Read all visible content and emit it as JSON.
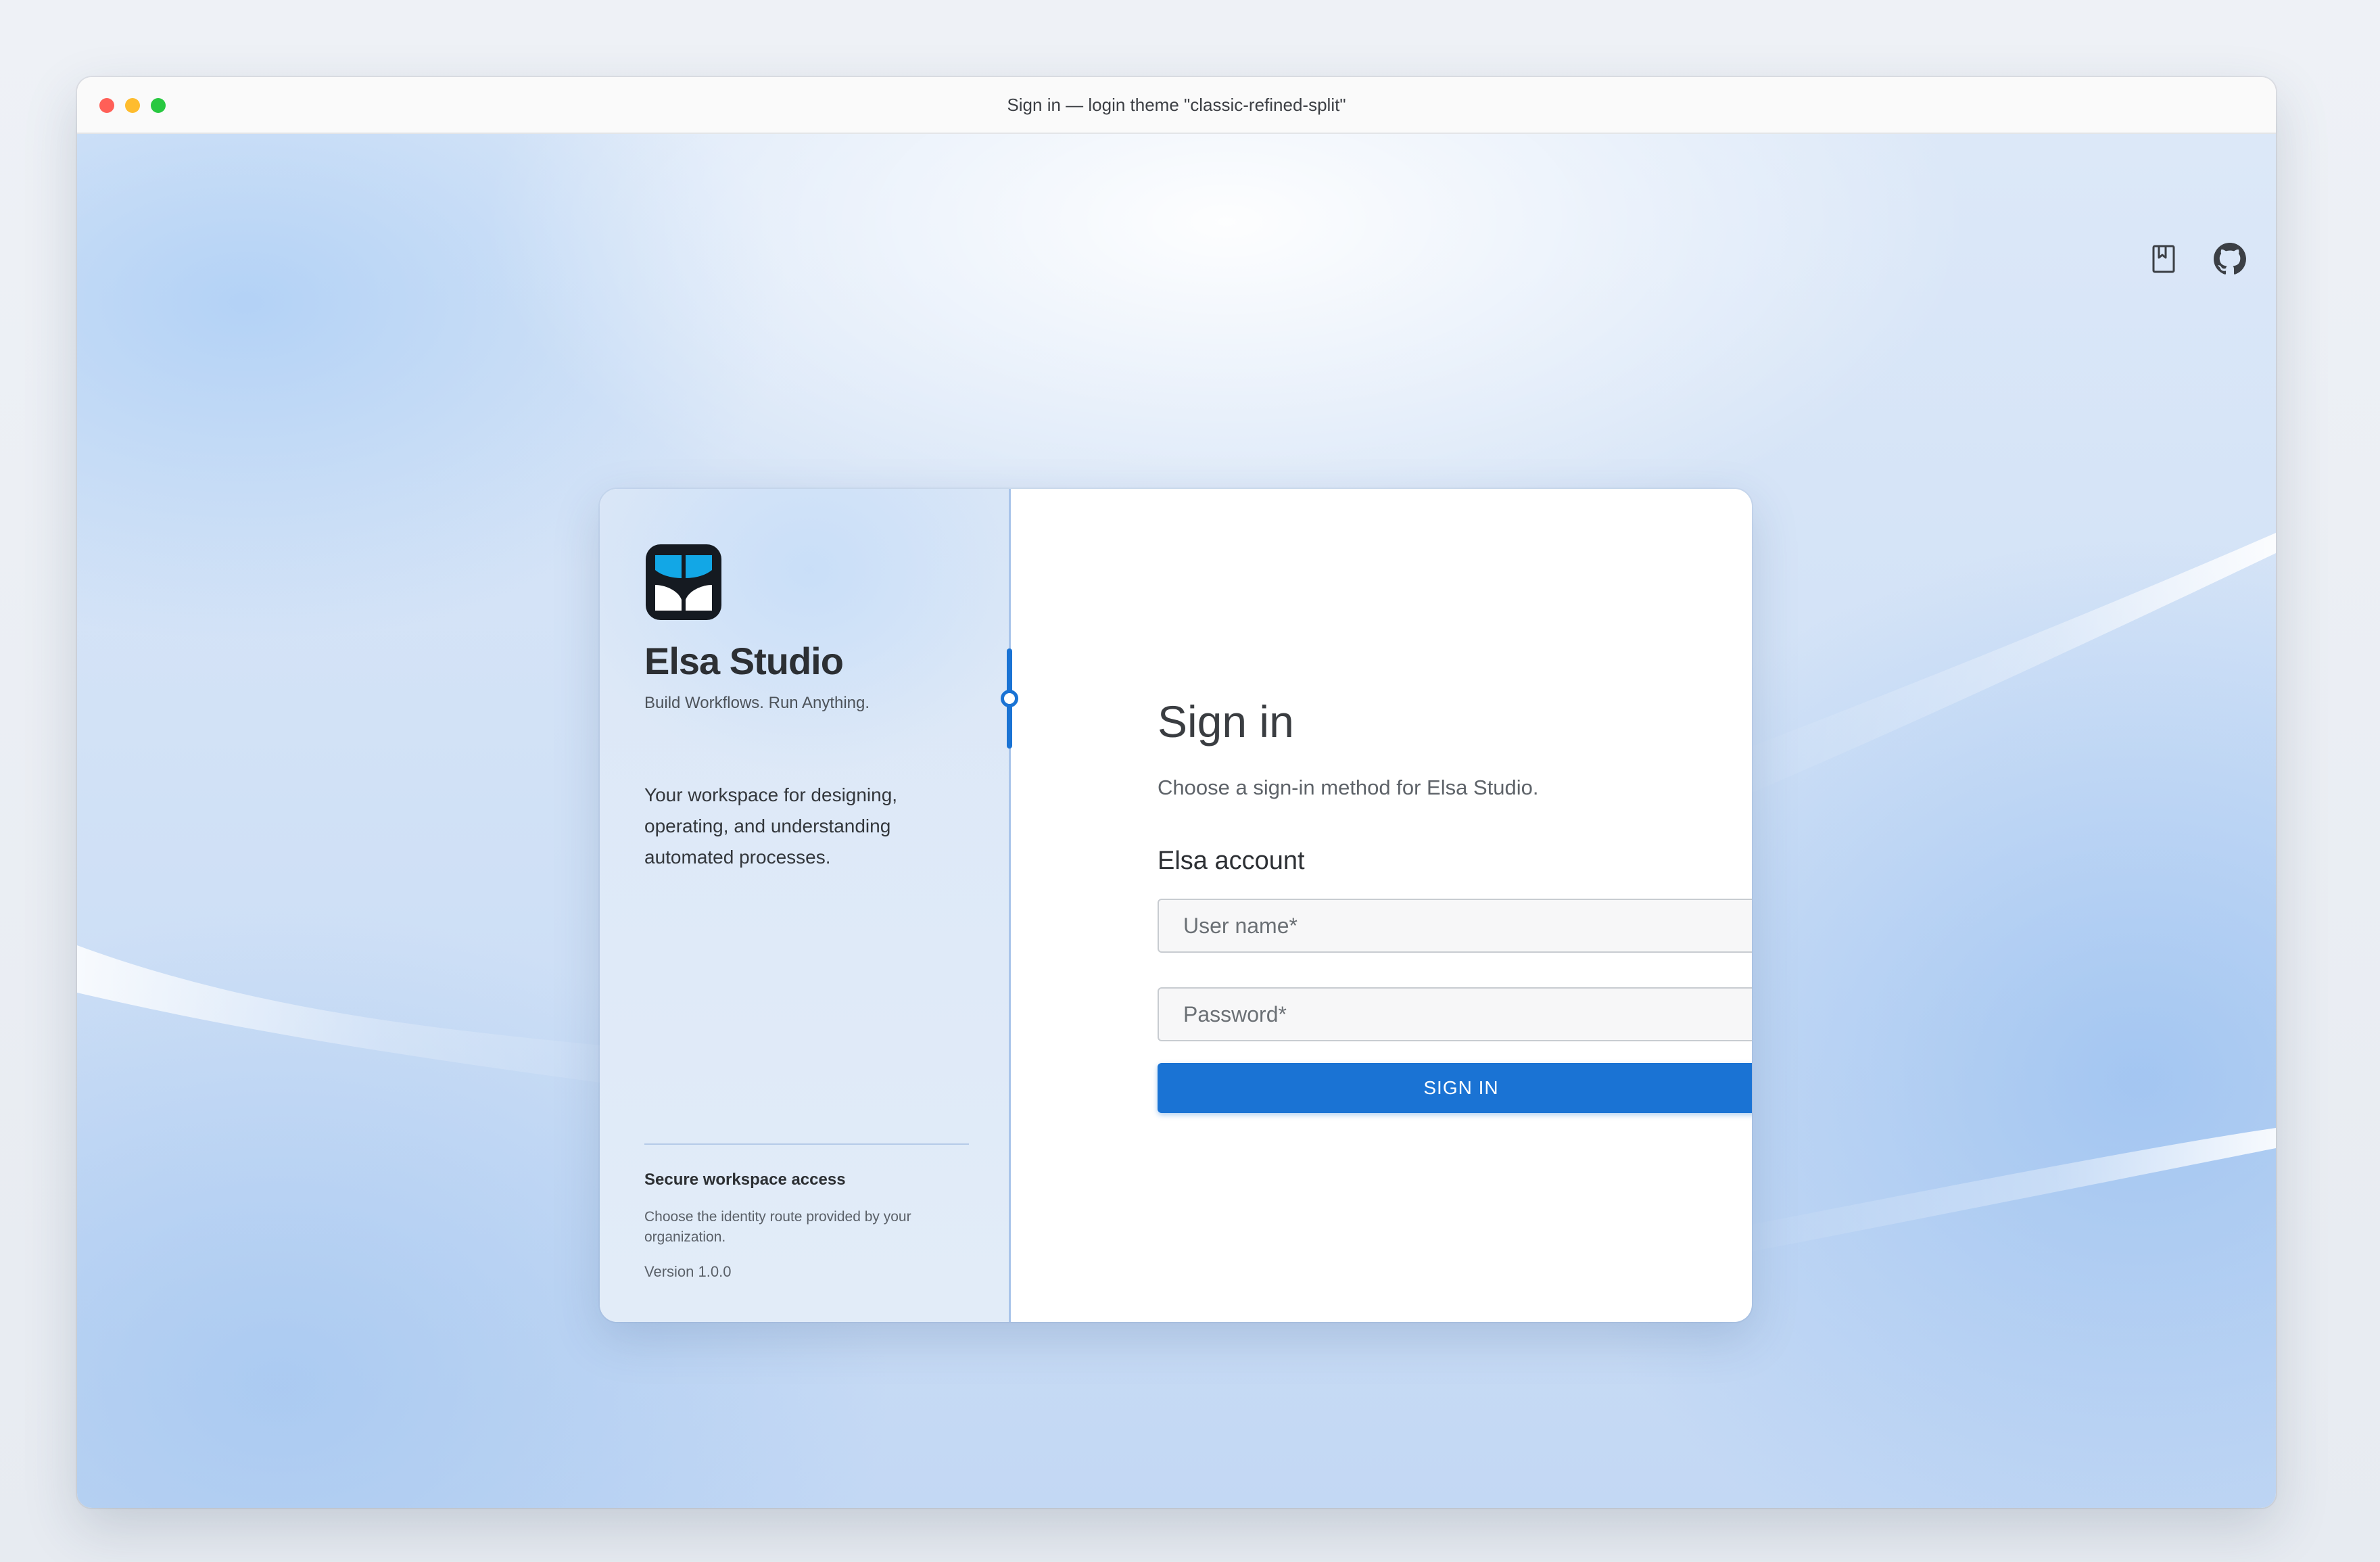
{
  "window": {
    "title": "Sign in — login theme \"classic-refined-split\""
  },
  "toolbar": {
    "icons": [
      "book-icon",
      "github-icon"
    ]
  },
  "brand": {
    "name": "Elsa Studio",
    "tagline": "Build Workflows. Run Anything.",
    "description": "Your workspace for designing, operating, and understanding automated processes.",
    "secure_title": "Secure workspace access",
    "secure_description": "Choose the identity route provided by your organization.",
    "version": "Version 1.0.0",
    "logo_colors": {
      "frame": "#151a21",
      "primary": "#12a7e6",
      "secondary": "#ffffff"
    }
  },
  "signin": {
    "title": "Sign in",
    "subtitle": "Choose a sign-in method for Elsa Studio.",
    "account_section": "Elsa account",
    "username_placeholder": "User name*",
    "username_value": "",
    "password_placeholder": "Password*",
    "password_value": "",
    "button_label": "SIGN IN"
  },
  "colors": {
    "accent": "#1a73d4",
    "panel_border": "#a9c4ea"
  }
}
